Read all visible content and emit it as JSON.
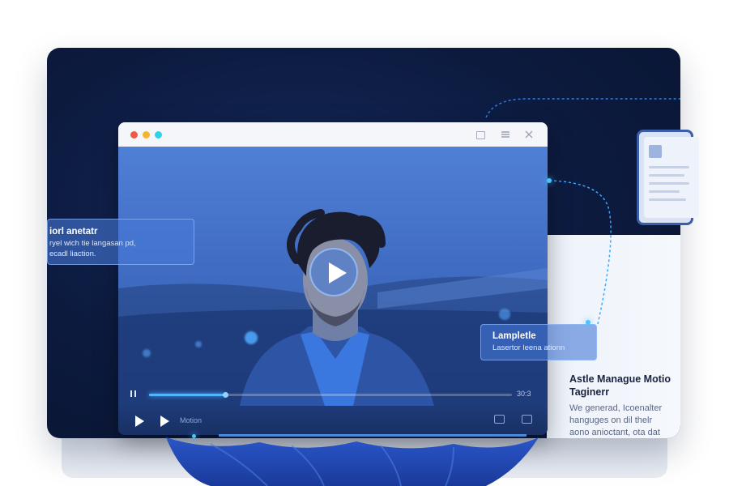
{
  "player": {
    "time": "30:3",
    "control_label": "Motion"
  },
  "callouts": {
    "left": {
      "title": "iorl anetatr",
      "text": "ryel wich tie langasan pd,\necadl liaction."
    },
    "right": {
      "title": "Lampletle",
      "text": "Lasertor leena ationn"
    }
  },
  "panel": {
    "title": "Astle Manague Motio\nTaginerr",
    "body": "We generad, Icoenalter\nhanguges on dil thelr\naono anioctant, ota dat"
  },
  "colors": {
    "card_bg": "#0c1a3e",
    "accent": "#47c4ff",
    "dot_red": "#f0584a",
    "dot_yellow": "#f5b52e",
    "dot_cyan": "#2fd2e6"
  },
  "progress": 0.21,
  "icons": {
    "play": "play-icon",
    "pause": "pause-icon",
    "captions": "captions-icon",
    "fullscreen": "fullscreen-icon"
  }
}
